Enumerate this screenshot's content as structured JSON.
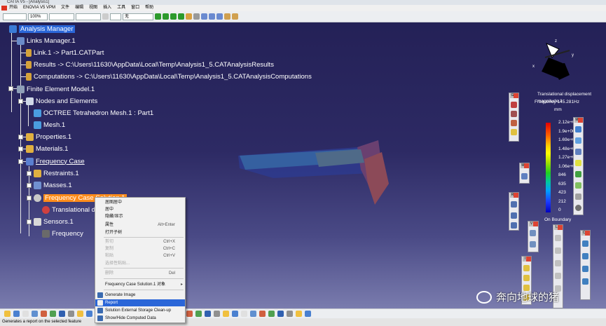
{
  "window": {
    "title": "CATIA V5 - [Analysis1]"
  },
  "menu": [
    "开始",
    "ENOVIA V5 VPM",
    "文件",
    "编辑",
    "视图",
    "插入",
    "工具",
    "窗口",
    "帮助"
  ],
  "toolbar": {
    "zoom": "100%",
    "color": "无"
  },
  "tree": {
    "analysis_manager": "Analysis Manager",
    "links_manager": "Links Manager.1",
    "link1": "Link.1 -> Part1.CATPart",
    "results": "Results -> C:\\Users\\11630\\AppData\\Local\\Temp\\Analysis1_5.CATAnalysisResults",
    "computations": "Computations -> C:\\Users\\11630\\AppData\\Local\\Temp\\Analysis1_5.CATAnalysisComputations",
    "fem": "Finite Element Model.1",
    "nodes": "Nodes and Elements",
    "octree": "OCTREE Tetrahedron Mesh.1 : Part1",
    "mesh": "Mesh.1",
    "properties": "Properties.1",
    "materials": "Materials.1",
    "freq_case": "Frequency Case",
    "restraints": "Restraints.1",
    "masses": "Masses.1",
    "freq_solution": "Frequency Case Solution.1",
    "translational": "Translational d",
    "sensors": "Sensors.1",
    "frequency": "Frequency"
  },
  "context_menu": {
    "center_graph": "居图居中",
    "center": "居中",
    "hide_show": "隐藏/显示",
    "properties": "属性",
    "properties_sc": "Alt+Enter",
    "open_child": "打开子树",
    "cut": "剪切",
    "cut_sc": "Ctrl+X",
    "copy": "复制",
    "copy_sc": "Ctrl+C",
    "paste": "粘贴",
    "paste_sc": "Ctrl+V",
    "paste_special": "选择性粘贴...",
    "delete": "删除",
    "delete_sc": "Del",
    "object": "Frequency Case Solution.1 对象",
    "generate_image": "Generate Image",
    "report": "Report",
    "storage": "Solution External Storage Clean-up",
    "show_hide": "Show/Hide Computed Data"
  },
  "legend": {
    "title": "Translational displacement magnitude.1",
    "frequency": "Frequency 145.281Hz",
    "unit": "mm",
    "values": [
      "2.12e+003",
      "1.9e+003",
      "1.69e+003",
      "1.48e+003",
      "1.27e+003",
      "1.06e+003",
      "846",
      "635",
      "423",
      "212",
      "0"
    ],
    "on_boundary": "On Boundary"
  },
  "compass": {
    "x": "x",
    "y": "y",
    "z": "z"
  },
  "status": "Generates a report on the selected feature",
  "watermark": "奔向地球的猪"
}
